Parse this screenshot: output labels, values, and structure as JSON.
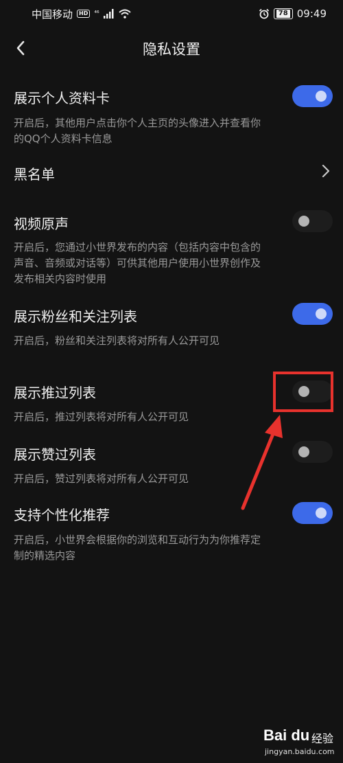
{
  "status_bar": {
    "carrier": "中国移动",
    "hd_badge": "HD",
    "network": "⁴⁶",
    "battery": "78",
    "time": "09:49"
  },
  "header": {
    "title": "隐私设置"
  },
  "settings": [
    {
      "title": "展示个人资料卡",
      "desc": "开启后，其他用户点击你个人主页的头像进入并查看你的QQ个人资料卡信息",
      "toggle": "on"
    },
    {
      "title": "黑名单",
      "type": "link"
    },
    {
      "title": "视频原声",
      "desc": "开启后，您通过小世界发布的内容（包括内容中包含的声音、音频或对话等）可供其他用户使用小世界创作及发布相关内容时使用",
      "toggle": "off"
    },
    {
      "title": "展示粉丝和关注列表",
      "desc": "开启后，粉丝和关注列表将对所有人公开可见",
      "toggle": "on"
    },
    {
      "title": "展示推过列表",
      "desc": "开启后，推过列表将对所有人公开可见",
      "toggle": "off"
    },
    {
      "title": "展示赞过列表",
      "desc": "开启后，赞过列表将对所有人公开可见",
      "toggle": "off"
    },
    {
      "title": "支持个性化推荐",
      "desc": "开启后，小世界会根据你的浏览和互动行为为你推荐定制的精选内容",
      "toggle": "on"
    }
  ],
  "watermark": {
    "logo": "Bai du",
    "label": "经验",
    "url": "jingyan.baidu.com"
  },
  "colors": {
    "background": "#131313",
    "toggle_on": "#3d6ae9",
    "highlight": "#e8322d"
  }
}
